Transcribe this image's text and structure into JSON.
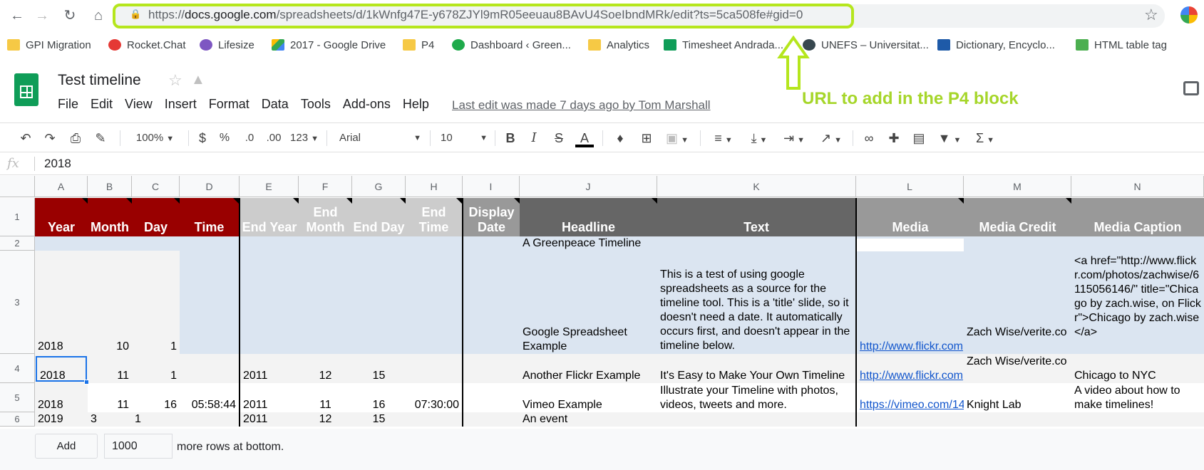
{
  "browser": {
    "url_scheme": "https://",
    "url_domain": "docs.google.com",
    "url_path": "/spreadsheets/d/1kWnfg47E-y678ZJYl9mR05eeuau8BAvU4SoeIbndMRk/edit?ts=5ca508fe#gid=0"
  },
  "bookmarks": [
    {
      "label": "GPI Migration",
      "icon": "folder-icon"
    },
    {
      "label": "Rocket.Chat",
      "icon": "rocket-icon"
    },
    {
      "label": "Lifesize",
      "icon": "lifesize-icon"
    },
    {
      "label": "2017 - Google Drive",
      "icon": "drive-icon"
    },
    {
      "label": "P4",
      "icon": "folder-icon"
    },
    {
      "label": "Dashboard ‹ Green...",
      "icon": "greenpeace-icon"
    },
    {
      "label": "Analytics",
      "icon": "folder-icon"
    },
    {
      "label": "Timesheet Andrada...",
      "icon": "sheets-icon"
    },
    {
      "label": "UNEFS – Universitat...",
      "icon": "unefs-icon"
    },
    {
      "label": "Dictionary, Encyclo...",
      "icon": "dictionary-icon"
    },
    {
      "label": "HTML table tag",
      "icon": "w3-icon"
    }
  ],
  "doc": {
    "title": "Test timeline",
    "menu": [
      "File",
      "Edit",
      "View",
      "Insert",
      "Format",
      "Data",
      "Tools",
      "Add-ons",
      "Help"
    ],
    "last_edit": "Last edit was made 7 days ago by Tom Marshall"
  },
  "annotation": "URL to add in the P4 block",
  "toolbar": {
    "zoom": "100%",
    "currency": "$",
    "percent": "%",
    "dec_less": ".0",
    "dec_more": ".00",
    "format_more": "123",
    "font": "Arial",
    "font_size": "10",
    "bold": "B",
    "italic": "I",
    "strike": "S",
    "text_color": "A"
  },
  "formula_bar": {
    "fx": "fx",
    "value": "2018"
  },
  "grid": {
    "columns": [
      "A",
      "B",
      "C",
      "D",
      "E",
      "F",
      "G",
      "H",
      "I",
      "J",
      "K",
      "L",
      "M",
      "N"
    ],
    "rows": [
      "1",
      "2",
      "3",
      "4",
      "5",
      "6"
    ],
    "headers": [
      "Year",
      "Month",
      "Day",
      "Time",
      "End Year",
      "End Month",
      "End Day",
      "End Time",
      "Display Date",
      "Headline",
      "Text",
      "Media",
      "Media Credit",
      "Media Caption"
    ],
    "data": {
      "r2_headline": "A Greenpeace Timeline",
      "r3_year": "2018",
      "r3_month": "10",
      "r3_day": "1",
      "r3_headline": "Google Spreadsheet Example",
      "r3_text": "This is a test of using google spreadsheets as a source for the timeline tool. This is a 'title' slide, so it doesn't need a date. It automatically occurs first, and doesn't appear in the timeline below.",
      "r3_media": "http://www.flickr.com",
      "r3_credit": "Zach Wise/verite.co",
      "r3_caption": "<a href=\"http://www.flickr.com/photos/zachwise/6115056146/\" title=\"Chicago by zach.wise, on Flickr\">Chicago by zach.wise</a>",
      "r4_year": "2018",
      "r4_month": "11",
      "r4_day": "1",
      "r4_endyear": "2011",
      "r4_endmonth": "12",
      "r4_endday": "15",
      "r4_headline": "Another Flickr Example",
      "r4_text": "It's Easy to Make Your Own Timeline",
      "r4_media": "http://www.flickr.com",
      "r4_credit": "Zach Wise/verite.co",
      "r4_caption": "Chicago to NYC",
      "r5_year": "2018",
      "r5_month": "11",
      "r5_day": "16",
      "r5_time": "05:58:44",
      "r5_endyear": "2011",
      "r5_endmonth": "11",
      "r5_endday": "16",
      "r5_endtime": "07:30:00",
      "r5_headline": "Vimeo Example",
      "r5_text": "Illustrate your Timeline with photos, videos, tweets and more.",
      "r5_media": "https://vimeo.com/14",
      "r5_credit": "Knight Lab",
      "r5_caption": "A video about how to make timelines!",
      "r6_year": "2019",
      "r6_month": "3",
      "r6_day": "1",
      "r6_endyear": "2011",
      "r6_endmonth": "12",
      "r6_endday": "15",
      "r6_headline": "An event"
    }
  },
  "footer": {
    "add_label": "Add",
    "rows_value": "1000",
    "more_text": "more rows at bottom."
  },
  "colors": {
    "highlight": "#b5e61d",
    "header_red": "#990000",
    "header_gray": "#cccccc",
    "header_dark": "#666666",
    "header_mid": "#999999",
    "row_band": "#dbe5f1"
  }
}
